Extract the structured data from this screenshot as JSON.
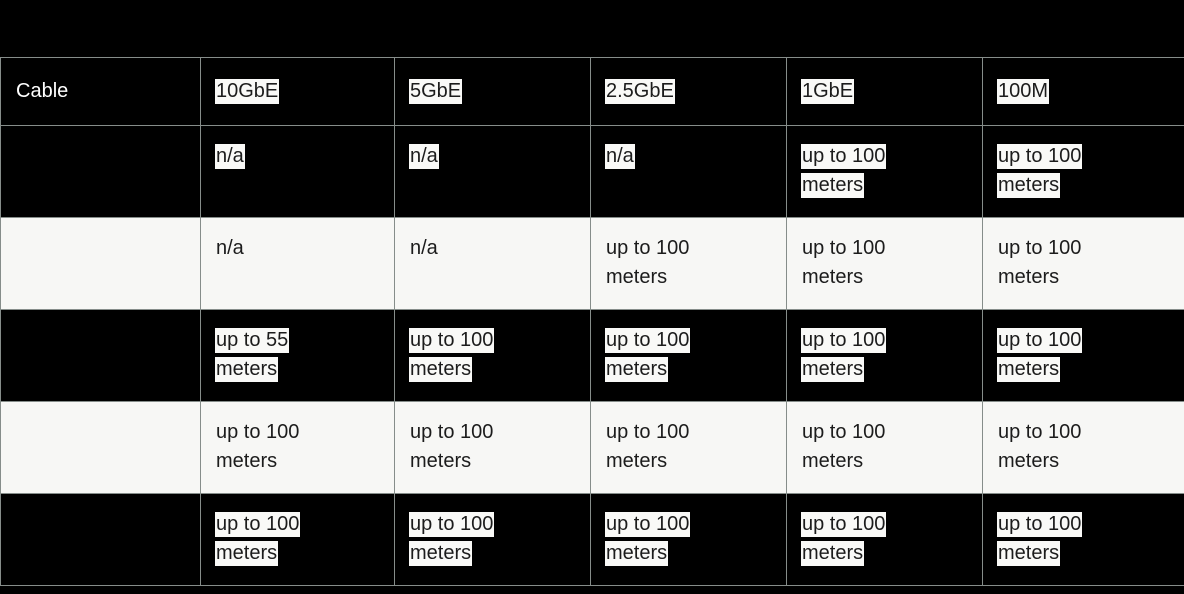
{
  "table": {
    "columns": [
      {
        "id": "cable",
        "label": "Cable",
        "style": "blue"
      },
      {
        "id": "10gbe",
        "label": "10GbE",
        "style": "red"
      },
      {
        "id": "5gbe",
        "label": "5GbE",
        "style": "dark"
      },
      {
        "id": "2_5gbe",
        "label": "2.5GbE",
        "style": "red"
      },
      {
        "id": "1gbe",
        "label": "1GbE",
        "style": "dark"
      },
      {
        "id": "100m",
        "label": "100M",
        "style": "dark"
      }
    ],
    "rows": [
      {
        "stripe": "dark",
        "cells": [
          "",
          "n/a",
          "n/a",
          "n/a",
          "up to 100\nmeters",
          "up to 100\nmeters"
        ]
      },
      {
        "stripe": "light",
        "cells": [
          "",
          "n/a",
          "n/a",
          "up to 100\nmeters",
          "up to 100\nmeters",
          "up to 100\nmeters"
        ]
      },
      {
        "stripe": "dark",
        "cells": [
          "",
          "up to 55\nmeters",
          "up to 100\nmeters",
          "up to 100\nmeters",
          "up to 100\nmeters",
          "up to 100\nmeters"
        ]
      },
      {
        "stripe": "light",
        "cells": [
          "",
          "up to 100\nmeters",
          "up to 100\nmeters",
          "up to 100\nmeters",
          "up to 100\nmeters",
          "up to 100\nmeters"
        ]
      },
      {
        "stripe": "dark",
        "cells": [
          "",
          "up to 100\nmeters",
          "up to 100\nmeters",
          "up to 100\nmeters",
          "up to 100\nmeters",
          "up to 100\nmeters"
        ]
      }
    ]
  },
  "colors": {
    "header_blue": "#4fa3f7",
    "header_red": "#fc5456",
    "dark_row": "#000000",
    "light_row": "#f7f7f5",
    "grid_line": "#868d8a",
    "table_border": "#c3dacb",
    "text": "#1c1c1c",
    "highlight": "#f9f9f7"
  }
}
